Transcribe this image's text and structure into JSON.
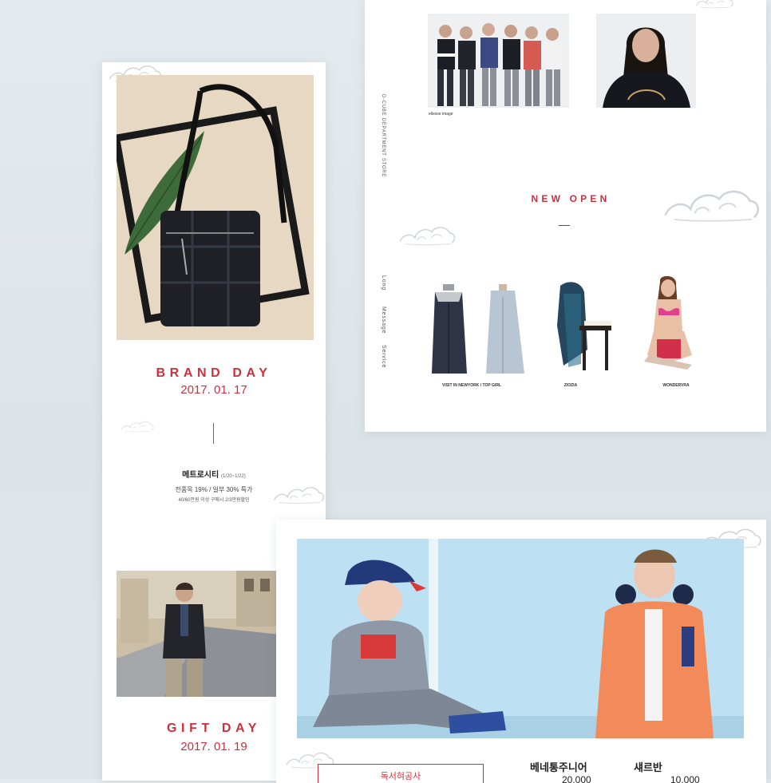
{
  "brand_day": {
    "title": "BRAND DAY",
    "date": "2017. 01. 17",
    "store_name": "메트로시티",
    "store_period": "(1/20~1/22)",
    "discount": "전품목 19% / 일부 30% 특가",
    "purchase": "40/60만원 이상 구매시 2/3만원할인"
  },
  "gift_day": {
    "title": "GIFT DAY",
    "date": "2017. 01. 19"
  },
  "new_open": {
    "title": "NEW OPEN",
    "vertical_store": "D-CUBE DEPARTMENT STORE",
    "vertical_menu": [
      "Long",
      "Message",
      "Service"
    ],
    "image_caption": "ellesse image",
    "products": [
      {
        "label": "VISIT IN NEWYORK / TOP GIRL"
      },
      {
        "label": "ZIOZIA"
      },
      {
        "label": "WONDERVRA"
      }
    ]
  },
  "kids": {
    "button_label": "독서혀공사",
    "brand1": "베네통주니어",
    "brand1_price": "20,000",
    "brand2": "섀르반",
    "brand2_price": "10,000"
  },
  "colors": {
    "accent_red": "#c8323c",
    "background": "#e0e7eb",
    "card": "#ffffff"
  }
}
